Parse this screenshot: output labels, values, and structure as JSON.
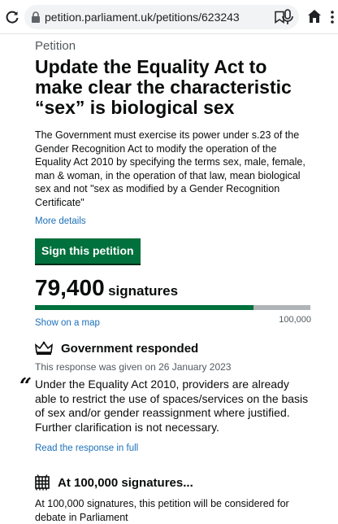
{
  "browser": {
    "url": "petition.parliament.uk/petitions/623243"
  },
  "petition": {
    "caption": "Petition",
    "title": "Update the Equality Act to make clear the characteristic “sex” is biological sex",
    "summary": "The Government must exercise its power under s.23 of the Gender Recognition Act to modify the operation of the Equality Act 2010 by specifying the terms sex, male, female, man & woman, in the operation of that law, mean biological sex and not \"sex as modified by a Gender Recognition Certificate\"",
    "more_details_label": "More details",
    "sign_label": "Sign this petition"
  },
  "signatures": {
    "count": "79,400",
    "label": "signatures",
    "progress_fraction": 0.794,
    "goal": "100,000",
    "map_link": "Show on a map"
  },
  "response": {
    "heading": "Government responded",
    "date_text": "This response was given on 26 January 2023",
    "quote_mark": "“",
    "quote": "Under the Equality Act 2010, providers are already able to restrict the use of spaces/services on the basis of sex and/or gender reassignment where justified. Further clarification is not necessary.",
    "read_link": "Read the response in full"
  },
  "debate": {
    "heading": "At 100,000 signatures...",
    "text": "At 100,000 signatures, this petition will be considered for debate in Parliament"
  },
  "colors": {
    "brand_green": "#00703c",
    "link_blue": "#1d70b8",
    "secondary_text": "#505a5f",
    "progress_track": "#b1b4b6"
  },
  "icons": [
    "reload-icon",
    "lock-icon",
    "bookmark-icon",
    "mic-icon",
    "home-icon",
    "menu-icon",
    "crown-icon",
    "portcullis-icon"
  ]
}
